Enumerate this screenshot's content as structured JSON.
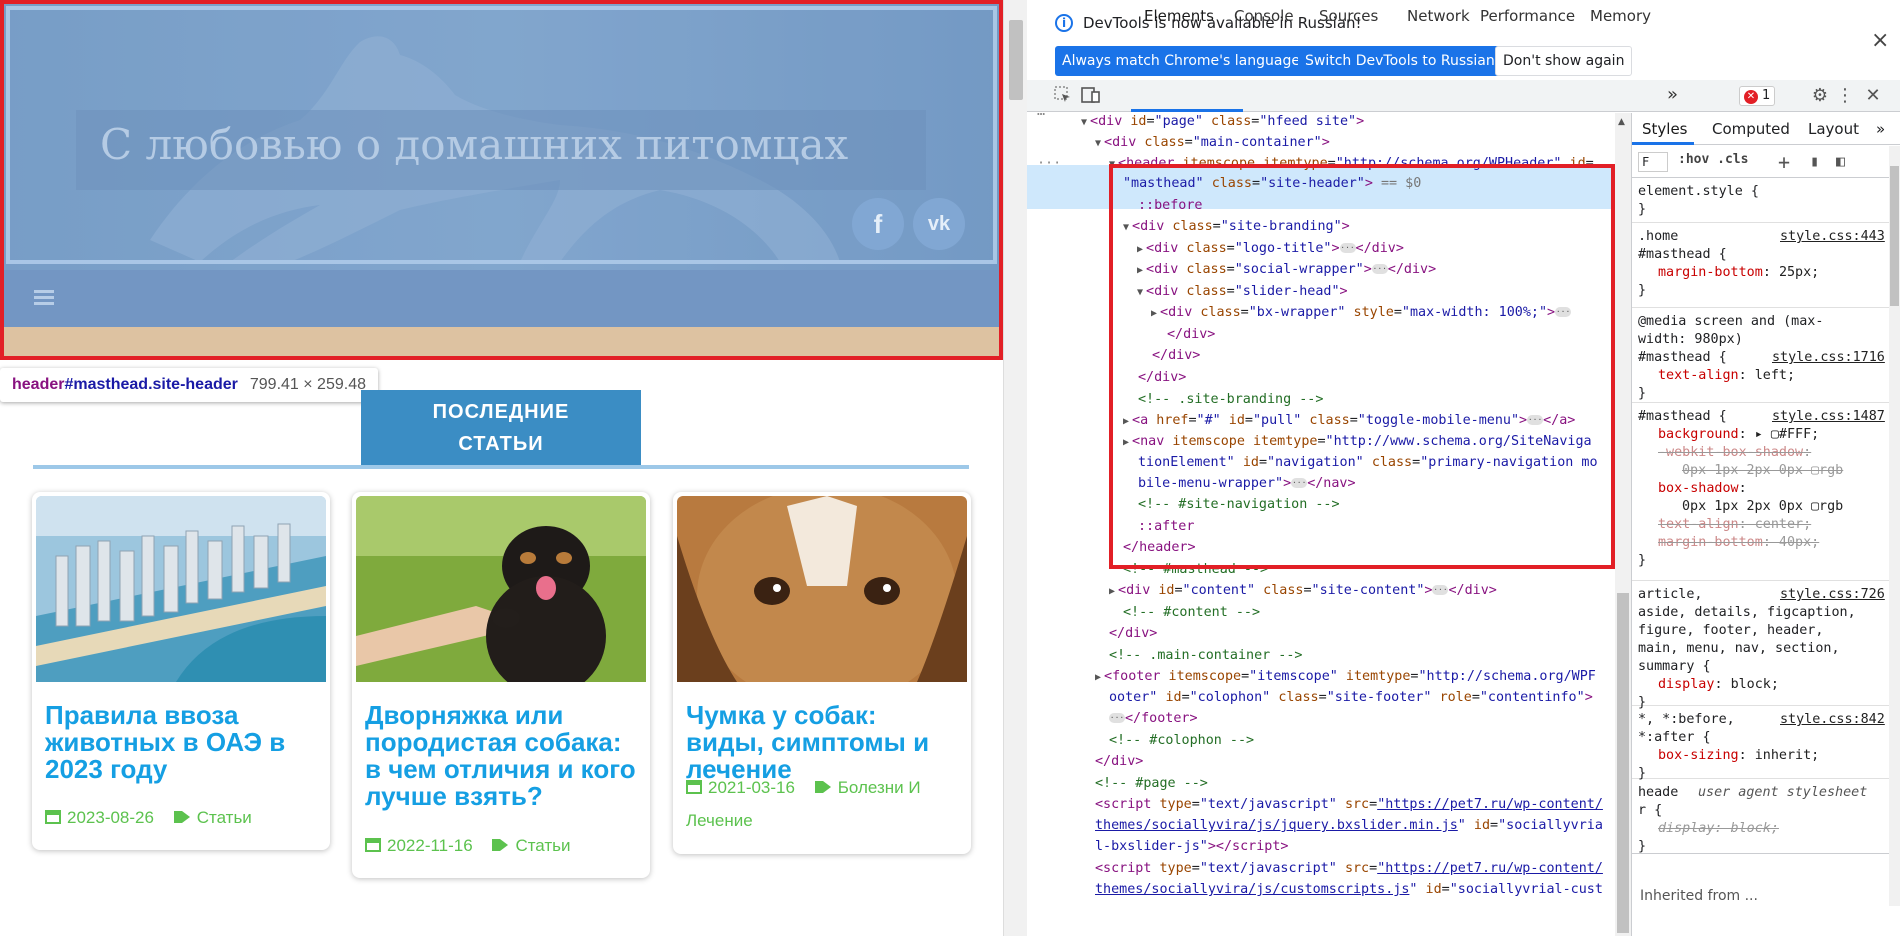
{
  "page": {
    "site_title": "С любовью о домашних питомцах",
    "social": {
      "fb": "f",
      "vk": "vk"
    },
    "section_tab_line1": "ПОСЛЕДНИЕ",
    "section_tab_line2": "СТАТЬИ",
    "tooltip": {
      "tag": "header",
      "id": "#masthead",
      "cls": ".site-header",
      "size": "799.41 × 259.48"
    },
    "cards": [
      {
        "title": "Правила ввоза животных в ОАЭ в 2023 году",
        "date": "2023-08-26",
        "category": "Статьи"
      },
      {
        "title": "Дворняжка или породистая собака: в чем отличия и кого лучше взять?",
        "date": "2022-11-16",
        "category": "Статьи"
      },
      {
        "title": "Чумка у собак: виды, симптомы и лечение",
        "date": "2021-03-16",
        "category_line1": "Болезни И",
        "category_line2": "Лечение"
      }
    ]
  },
  "devtools": {
    "banner": {
      "message": "DevTools is now available in Russian!",
      "btn_match": "Always match Chrome's language",
      "btn_switch": "Switch DevTools to Russian",
      "btn_dismiss": "Don't show again",
      "close": "×"
    },
    "tabs": [
      "Elements",
      "Console",
      "Sources",
      "Network",
      "Performance",
      "Memory"
    ],
    "more_tabs": "»",
    "error_count": "1",
    "styles_tabs": [
      "Styles",
      "Computed",
      "Layout"
    ],
    "filter_placeholder": "F",
    "filter_toggles": ":hov  .cls",
    "inherited": "Inherited from ..."
  }
}
